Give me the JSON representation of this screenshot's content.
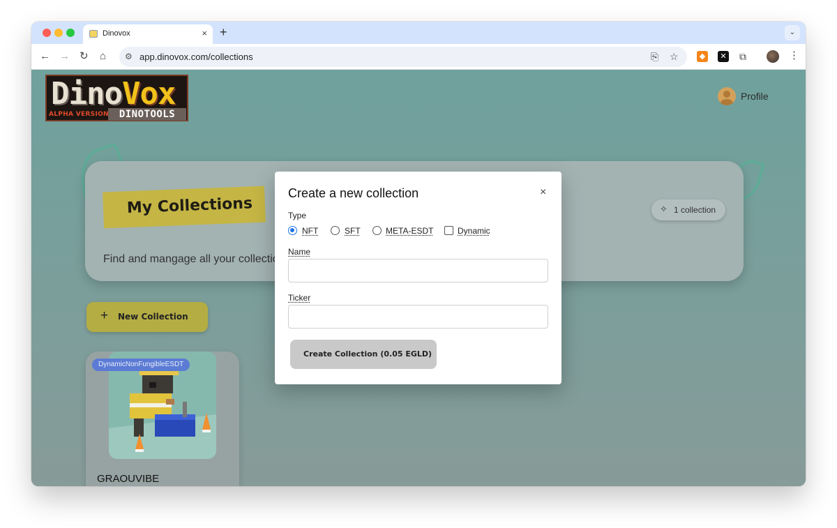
{
  "browser": {
    "tab_title": "Dinovox",
    "tab_close": "×",
    "new_tab": "+",
    "tab_menu": "⌄",
    "url": "app.dinovox.com/collections",
    "icons": [
      "back-icon",
      "forward-icon",
      "reload-icon",
      "home-icon",
      "site-info-icon",
      "install-icon",
      "bookmark-star-icon",
      "metamask-icon",
      "x-extension-icon",
      "extensions-puzzle-icon",
      "profile-icon",
      "menu-icon"
    ]
  },
  "header": {
    "logo": {
      "main_dino": "Dino",
      "main_vox": "Vox",
      "alpha": "ALPHA VERSION",
      "tools": "DINOTOOLS"
    },
    "profile_label": "Profile"
  },
  "hero": {
    "title": "My Collections",
    "subtitle": "Find and mangage all your collection",
    "count_label": "1 collection"
  },
  "actions": {
    "new_collection": "New Collection"
  },
  "collections": [
    {
      "badge": "DynamicNonFungibleESDT",
      "name": "GRAOUVIBE"
    }
  ],
  "modal": {
    "title": "Create a new collection",
    "close": "×",
    "type_label": "Type",
    "type_options": [
      {
        "label": "NFT",
        "checked": true
      },
      {
        "label": "SFT",
        "checked": false
      },
      {
        "label": "META-ESDT",
        "checked": false
      }
    ],
    "dynamic_label": "Dynamic",
    "dynamic_checked": false,
    "name_label": "Name",
    "name_value": "",
    "ticker_label": "Ticker",
    "ticker_value": "",
    "submit_label": "Create Collection (0.05 EGLD)"
  },
  "colors": {
    "page_bg": "#7ea29f",
    "accent_yellow": "#c4b545",
    "badge_blue": "#5b7bd4",
    "radio_blue": "#1a73e8"
  }
}
